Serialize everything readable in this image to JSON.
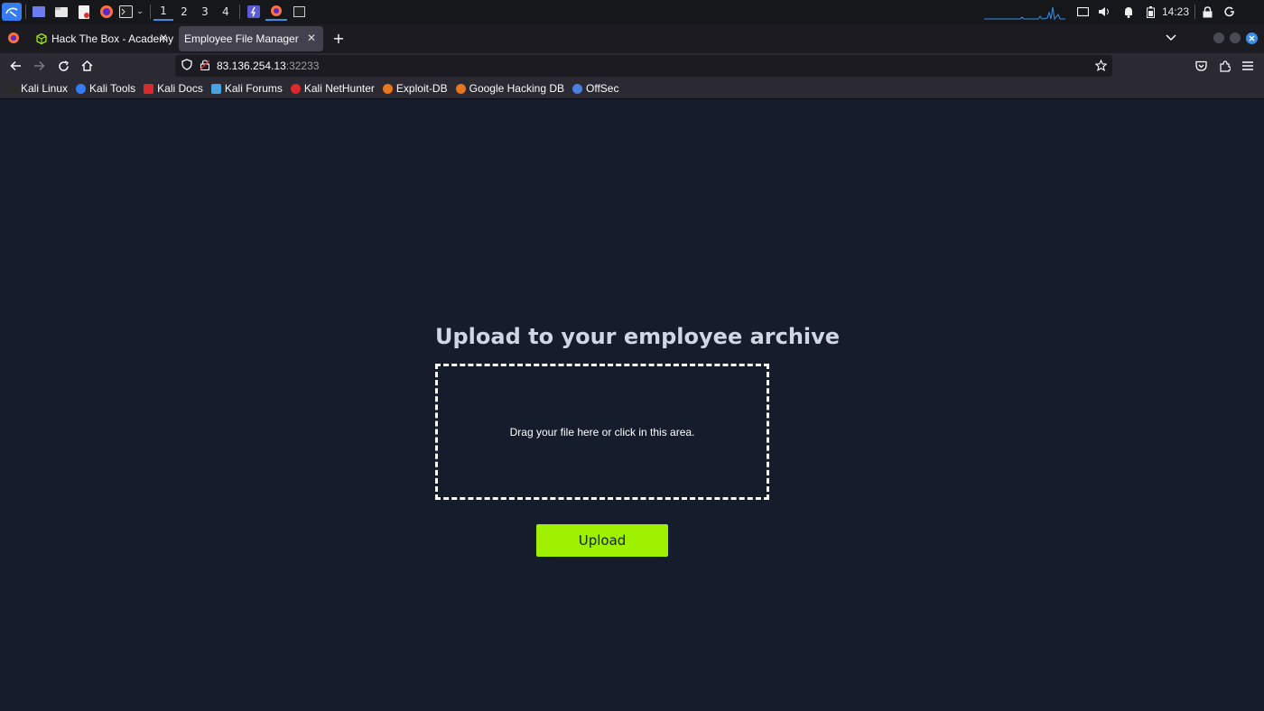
{
  "taskbar": {
    "workspaces": [
      "1",
      "2",
      "3",
      "4"
    ],
    "clock": "14:23"
  },
  "tabs": [
    {
      "label": "Hack The Box - Academy",
      "active": false
    },
    {
      "label": "Employee File Manager",
      "active": true
    }
  ],
  "navbar": {
    "url_host": "83.136.254.13",
    "url_port": ":32233"
  },
  "bookmarks": [
    {
      "label": "Kali Linux",
      "color": "#2a2a2a"
    },
    {
      "label": "Kali Tools",
      "color": "#367bf0"
    },
    {
      "label": "Kali Docs",
      "color": "#d92b2b"
    },
    {
      "label": "Kali Forums",
      "color": "#4aa3df"
    },
    {
      "label": "Kali NetHunter",
      "color": "#d92b2b"
    },
    {
      "label": "Exploit-DB",
      "color": "#e8761d"
    },
    {
      "label": "Google Hacking DB",
      "color": "#e8761d"
    },
    {
      "label": "OffSec",
      "color": "#4a7fe0"
    }
  ],
  "page": {
    "title": "Upload to your employee archive",
    "dropzone_text": "Drag your file here or click in this area.",
    "upload_label": "Upload"
  },
  "colors": {
    "page_bg": "#151c2b",
    "accent": "#9fef00",
    "taskbar_bg": "#15171b",
    "browser_chrome": "#2b2a33"
  }
}
